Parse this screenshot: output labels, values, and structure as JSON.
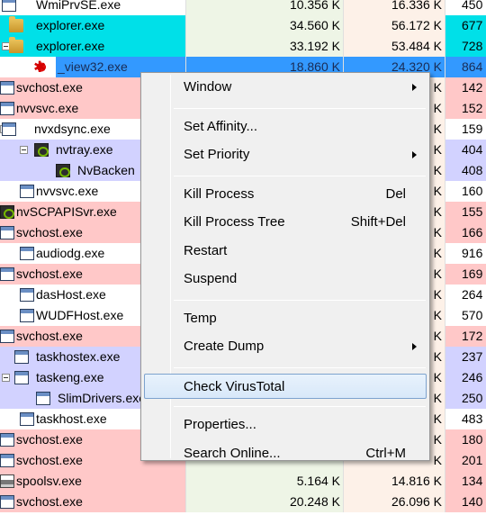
{
  "processes": [
    {
      "name": "WmiPrvSE.exe",
      "private": "10.356 K",
      "working_set": "16.336 K",
      "pid": "450",
      "bg": "white",
      "icon": "window-icon"
    },
    {
      "name": "explorer.exe",
      "private": "34.560 K",
      "working_set": "56.172 K",
      "pid": "677",
      "bg": "cyan",
      "icon": "folder-icon"
    },
    {
      "name": "explorer.exe",
      "private": "33.192 K",
      "working_set": "53.484 K",
      "pid": "728",
      "bg": "cyan",
      "icon": "folder-icon",
      "expandable": true
    },
    {
      "name": "_view32.exe",
      "private": "18.860 K",
      "working_set": "24.320 K",
      "pid": "864",
      "bg": "selected",
      "icon": "red-burst-icon"
    },
    {
      "name": "svchost.exe",
      "private": "",
      "working_set": "K",
      "pid": "142",
      "bg": "pink",
      "icon": "window-icon"
    },
    {
      "name": "nvvsvc.exe",
      "private": "",
      "working_set": "K",
      "pid": "152",
      "bg": "pink",
      "icon": "window-icon"
    },
    {
      "name": "nvxdsync.exe",
      "private": "",
      "working_set": "K",
      "pid": "159",
      "bg": "white",
      "icon": "window-icon",
      "expandable": true
    },
    {
      "name": "nvtray.exe",
      "private": "",
      "working_set": "K",
      "pid": "404",
      "bg": "lavender",
      "icon": "nvidia-icon",
      "expandable": true
    },
    {
      "name": "NvBacken",
      "private": "",
      "working_set": "K",
      "pid": "408",
      "bg": "lavender",
      "icon": "nvidia-icon"
    },
    {
      "name": "nvvsvc.exe",
      "private": "",
      "working_set": "K",
      "pid": "160",
      "bg": "white",
      "icon": "window-icon"
    },
    {
      "name": "nvSCPAPISvr.exe",
      "private": "",
      "working_set": "K",
      "pid": "155",
      "bg": "pink",
      "icon": "nvidia-icon"
    },
    {
      "name": "svchost.exe",
      "private": "",
      "working_set": "K",
      "pid": "166",
      "bg": "pink",
      "icon": "window-icon"
    },
    {
      "name": "audiodg.exe",
      "private": "",
      "working_set": "K",
      "pid": "916",
      "bg": "white",
      "icon": "window-icon"
    },
    {
      "name": "svchost.exe",
      "private": "",
      "working_set": "K",
      "pid": "169",
      "bg": "pink",
      "icon": "window-icon"
    },
    {
      "name": "dasHost.exe",
      "private": "",
      "working_set": "K",
      "pid": "264",
      "bg": "white",
      "icon": "window-icon"
    },
    {
      "name": "WUDFHost.exe",
      "private": "",
      "working_set": "K",
      "pid": "570",
      "bg": "white",
      "icon": "window-icon"
    },
    {
      "name": "svchost.exe",
      "private": "",
      "working_set": "K",
      "pid": "172",
      "bg": "pink",
      "icon": "window-icon"
    },
    {
      "name": "taskhostex.exe",
      "private": "",
      "working_set": "K",
      "pid": "237",
      "bg": "lavender",
      "icon": "window-icon"
    },
    {
      "name": "taskeng.exe",
      "private": "",
      "working_set": "K",
      "pid": "246",
      "bg": "lavender",
      "icon": "window-icon",
      "expandable": true
    },
    {
      "name": "SlimDrivers.exe",
      "private": "",
      "working_set": "K",
      "pid": "250",
      "bg": "lavender",
      "icon": "window-icon"
    },
    {
      "name": "taskhost.exe",
      "private": "",
      "working_set": "K",
      "pid": "483",
      "bg": "white",
      "icon": "window-icon"
    },
    {
      "name": "svchost.exe",
      "private": "",
      "working_set": "K",
      "pid": "180",
      "bg": "pink",
      "icon": "window-icon"
    },
    {
      "name": "svchost.exe",
      "private": "",
      "working_set": "K",
      "pid": "201",
      "bg": "pink",
      "icon": "window-icon"
    },
    {
      "name": "spoolsv.exe",
      "private": "5.164 K",
      "working_set": "14.816 K",
      "pid": "134",
      "bg": "pink",
      "icon": "printer-icon"
    },
    {
      "name": "svchost.exe",
      "private": "20.248 K",
      "working_set": "26.096 K",
      "pid": "140",
      "bg": "pink",
      "icon": "window-icon"
    }
  ],
  "context_menu": {
    "items": [
      {
        "label": "Window",
        "shortcut": "",
        "submenu": true
      },
      {
        "separator": true
      },
      {
        "label": "Set Affinity...",
        "shortcut": "",
        "submenu": false
      },
      {
        "label": "Set Priority",
        "shortcut": "",
        "submenu": true
      },
      {
        "separator": true
      },
      {
        "label": "Kill Process",
        "shortcut": "Del",
        "submenu": false
      },
      {
        "label": "Kill Process Tree",
        "shortcut": "Shift+Del",
        "submenu": false
      },
      {
        "label": "Restart",
        "shortcut": "",
        "submenu": false
      },
      {
        "label": "Suspend",
        "shortcut": "",
        "submenu": false
      },
      {
        "separator": true
      },
      {
        "label": "Temp",
        "shortcut": "",
        "submenu": false
      },
      {
        "label": "Create Dump",
        "shortcut": "",
        "submenu": true
      },
      {
        "separator": true
      },
      {
        "label": "Check VirusTotal",
        "shortcut": "",
        "submenu": false,
        "highlighted": true
      },
      {
        "separator": true
      },
      {
        "label": "Properties...",
        "shortcut": "",
        "submenu": false
      },
      {
        "label": "Search Online...",
        "shortcut": "Ctrl+M",
        "submenu": false
      }
    ]
  },
  "colors": {
    "cyan_row": "#00e0e8",
    "pink_row": "#ffc8c8",
    "lavender_row": "#d2d2ff",
    "selected_row": "#3399ff",
    "private_bytes_column": "#eef5e6",
    "working_set_column": "#fdf1e8",
    "menu_background": "#f0f0f0",
    "menu_highlight_border": "#7da2ce"
  }
}
